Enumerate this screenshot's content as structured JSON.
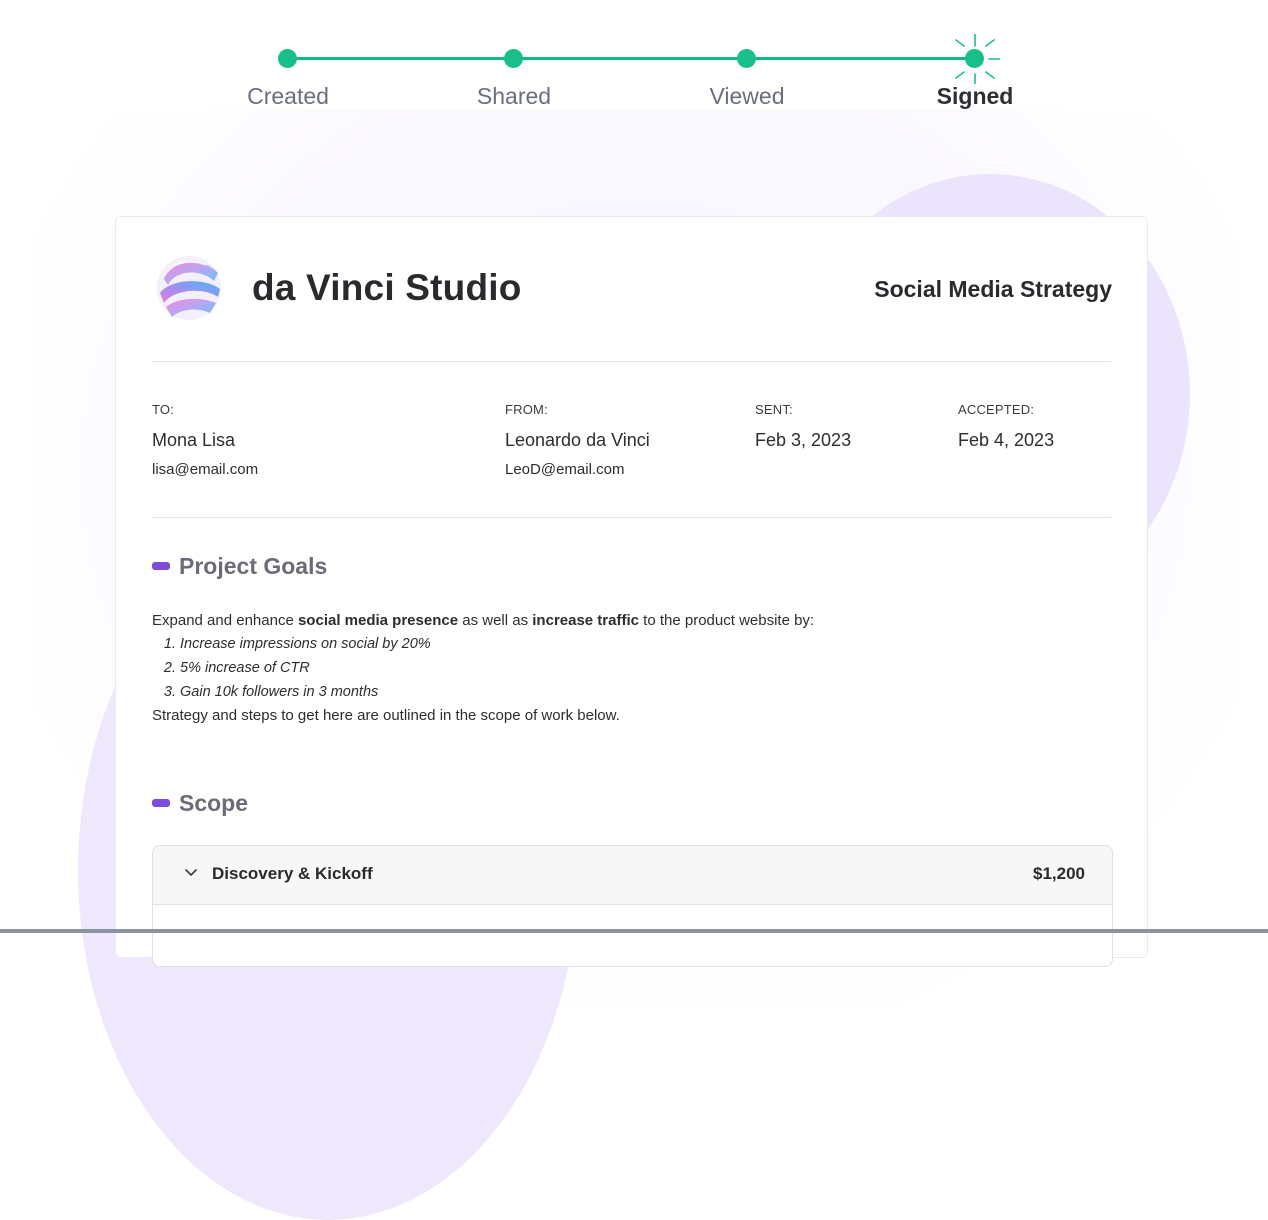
{
  "progress": {
    "steps": [
      {
        "label": "Created"
      },
      {
        "label": "Shared"
      },
      {
        "label": "Viewed"
      },
      {
        "label": "Signed"
      }
    ],
    "current_step": "Signed",
    "accent_color": "#18bf8a"
  },
  "document": {
    "company_name": "da Vinci Studio",
    "title": "Social Media Strategy",
    "to": {
      "label": "TO:",
      "name": "Mona Lisa",
      "email": "lisa@email.com"
    },
    "from": {
      "label": "FROM:",
      "name": "Leonardo da Vinci",
      "email": "LeoD@email.com"
    },
    "sent": {
      "label": "SENT:",
      "date": "Feb 3, 2023"
    },
    "accepted": {
      "label": "ACCEPTED:",
      "date": "Feb 4, 2023"
    },
    "goals": {
      "heading": "Project Goals",
      "intro_1": "Expand and enhance ",
      "intro_bold_1": "social media presence",
      "intro_2": " as well as ",
      "intro_bold_2": "increase traffic",
      "intro_3": " to the product website by:",
      "items": [
        {
          "num": "1.",
          "text": "Increase impressions on social by 20%"
        },
        {
          "num": "2.",
          "text": "5% increase of CTR"
        },
        {
          "num": "3.",
          "text": "Gain 10k followers in 3 months"
        }
      ],
      "outro": "Strategy and steps to get here are outlined in the scope of work below."
    },
    "scope": {
      "heading": "Scope",
      "items": [
        {
          "name": "Discovery & Kickoff",
          "price": "$1,200"
        }
      ]
    },
    "section_accent_color": "#7c4ddd"
  }
}
